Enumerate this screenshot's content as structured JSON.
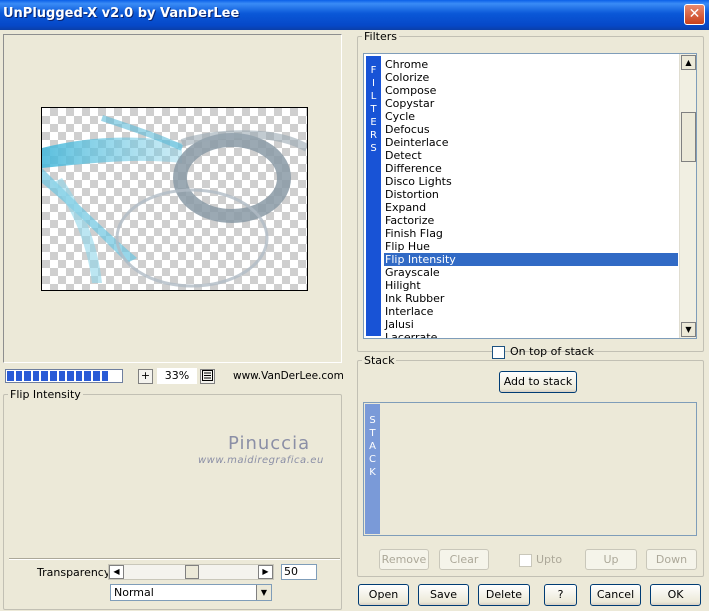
{
  "window": {
    "title": "UnPlugged-X v2.0 by VanDerLee",
    "close_glyph": "✕"
  },
  "preview": {
    "zoom": "33%",
    "plus": "+",
    "url": "www.VanDerLee.com",
    "zoom_segments": 12
  },
  "filters": {
    "legend": "Filters",
    "vertical_label": [
      "F",
      "I",
      "L",
      "T",
      "E",
      "R",
      "S"
    ],
    "items": [
      "Chrome",
      "Colorize",
      "Compose",
      "Copystar",
      "Cycle",
      "Defocus",
      "Deinterlace",
      "Detect",
      "Difference",
      "Disco Lights",
      "Distortion",
      "Expand",
      "Factorize",
      "Finish Flag",
      "Flip Hue",
      "Flip Intensity",
      "Grayscale",
      "Hilight",
      "Ink Rubber",
      "Interlace",
      "Jalusi",
      "Lacerrate"
    ],
    "selected": "Flip Intensity",
    "on_top_label": "On top of stack",
    "scroll_up": "▲",
    "scroll_down": "▼"
  },
  "stack": {
    "legend": "Stack",
    "add_label": "Add to stack",
    "vertical_label": [
      "S",
      "T",
      "A",
      "C",
      "K"
    ],
    "remove_label": "Remove",
    "clear_label": "Clear",
    "upto_label": "Upto",
    "up_label": "Up",
    "down_label": "Down"
  },
  "filter_settings": {
    "legend": "Flip Intensity",
    "watermark_name": "Pinuccia",
    "watermark_url": "www.maidiregrafica.eu",
    "transparency_label": "Transparency",
    "transparency_value": "50",
    "slider_left": "◀",
    "slider_right": "▶",
    "blend_mode": "Normal",
    "blend_arrow": "▼"
  },
  "buttons": {
    "open": "Open",
    "save": "Save",
    "delete": "Delete",
    "help": "?",
    "cancel": "Cancel",
    "ok": "OK"
  },
  "colors": {
    "titlebar": "#0a58d8",
    "selection": "#316ac5",
    "filters_bar": "#1853d6",
    "stack_bar": "#7a9ad8",
    "progress": "#2a5bd6"
  }
}
